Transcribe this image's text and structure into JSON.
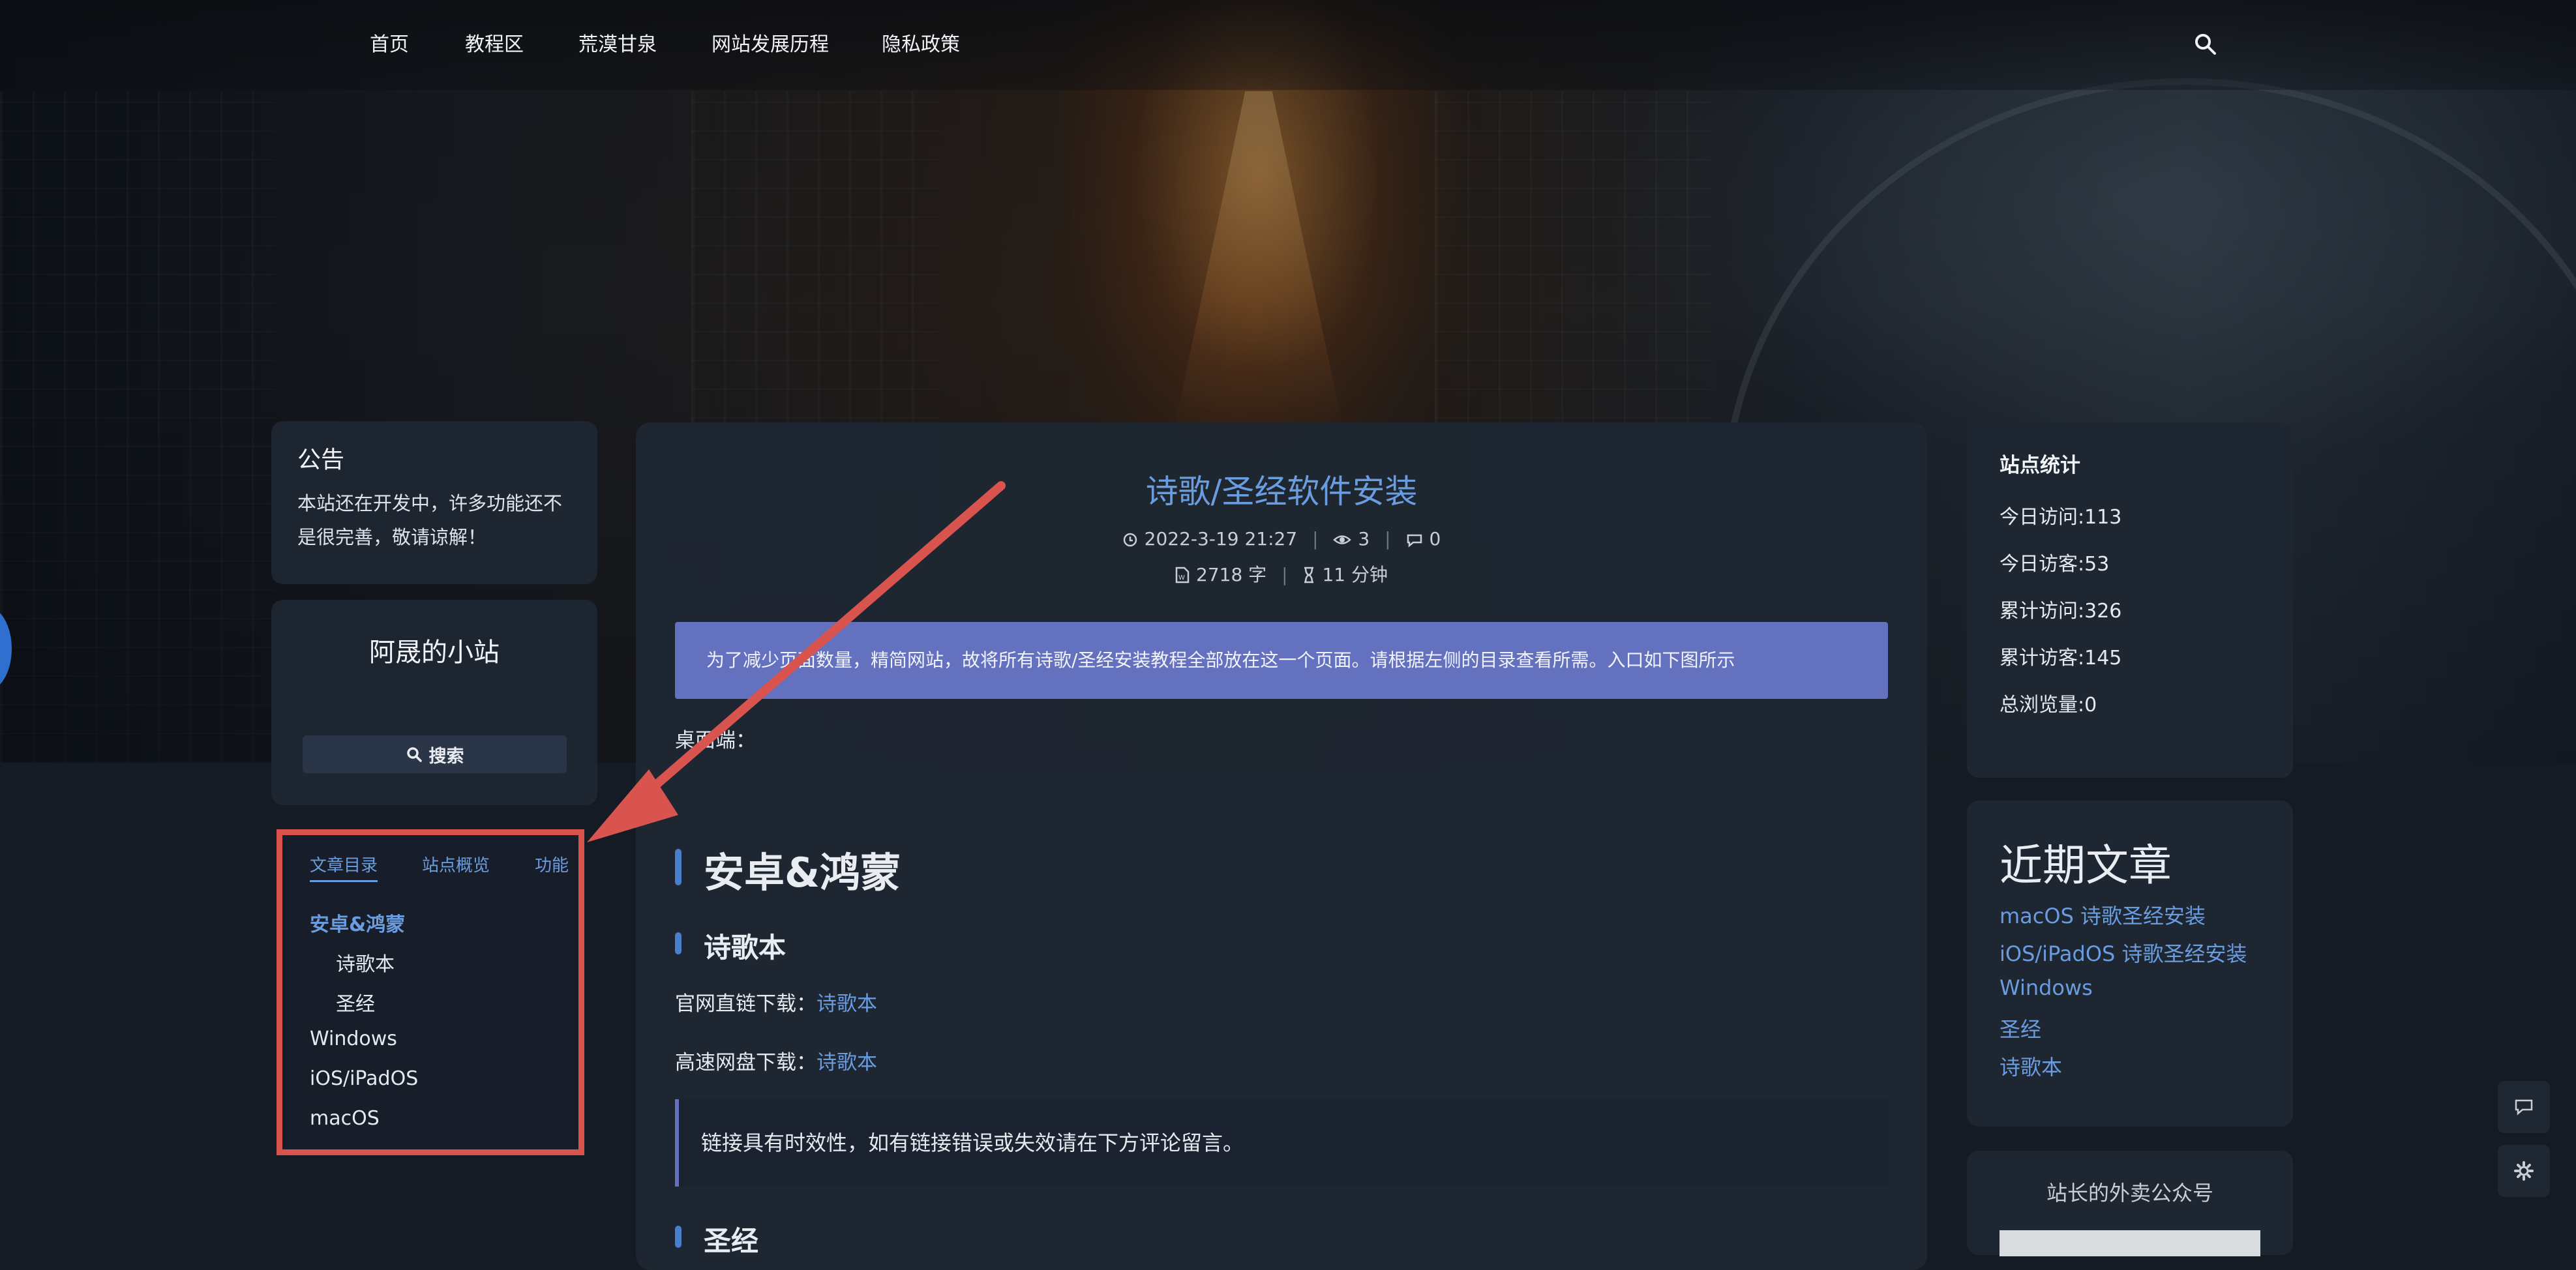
{
  "nav": {
    "items": [
      "首页",
      "教程区",
      "荒漠甘泉",
      "网站发展历程",
      "隐私政策"
    ],
    "search_icon": "search-icon"
  },
  "notice": {
    "title": "公告",
    "line1": "本站还在开发中，许多功能还不",
    "line2": "是很完善，敬请谅解！"
  },
  "site": {
    "name": "阿晟的小站",
    "search_label": "搜索"
  },
  "toc": {
    "tabs": [
      "文章目录",
      "站点概览",
      "功能"
    ],
    "items": [
      {
        "label": "安卓&鸿蒙",
        "level": 1,
        "active": true
      },
      {
        "label": "诗歌本",
        "level": 2,
        "active": false
      },
      {
        "label": "圣经",
        "level": 2,
        "active": false
      },
      {
        "label": "Windows",
        "level": 1,
        "active": false
      },
      {
        "label": "iOS/iPadOS",
        "level": 1,
        "active": false
      },
      {
        "label": "macOS",
        "level": 1,
        "active": false
      }
    ]
  },
  "article": {
    "title": "诗歌/圣经软件安装",
    "date": "2022-3-19 21:27",
    "views": "3",
    "comments": "0",
    "words": "2718 字",
    "read_time": "11 分钟",
    "banner": "为了减少页面数量，精简网站，故将所有诗歌/圣经安装教程全部放在这一个页面。请根据左侧的目录查看所需。入口如下图所示",
    "desktop_label": "桌面端：",
    "h2_android": "安卓&鸿蒙",
    "h3_hymnal": "诗歌本",
    "official_label": "官网直链下载：",
    "official_link": "诗歌本",
    "fast_label": "高速网盘下载：",
    "fast_link": "诗歌本",
    "quote": "链接具有时效性，如有链接错误或失效请在下方评论留言。",
    "h3_bible": "圣经"
  },
  "stats": {
    "title": "站点统计",
    "items": [
      "今日访问:113",
      "今日访客:53",
      "累计访问:326",
      "累计访客:145",
      "总浏览量:0"
    ]
  },
  "recent": {
    "title": "近期文章",
    "links": [
      "macOS 诗歌圣经安装",
      "iOS/iPadOS 诗歌圣经安装",
      "Windows",
      "圣经",
      "诗歌本"
    ]
  },
  "wechat": {
    "title": "站长的外卖公众号"
  },
  "colors": {
    "accent": "#6a9ce0",
    "banner": "#6471bf",
    "highlight_border": "#d9534f"
  }
}
